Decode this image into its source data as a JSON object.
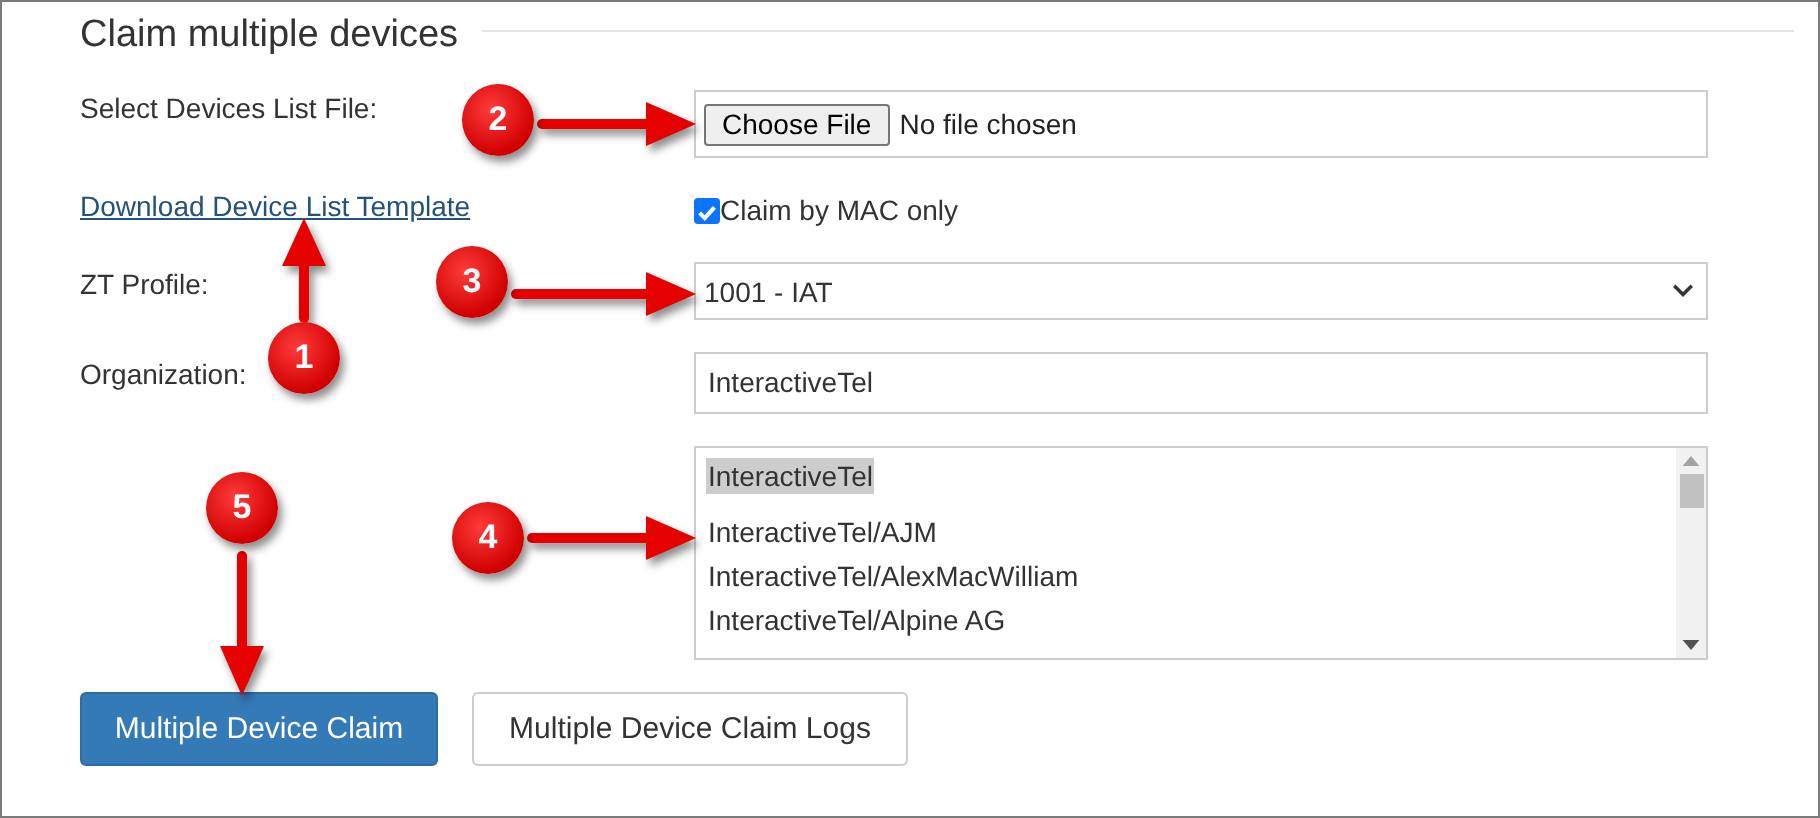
{
  "section": {
    "title": "Claim multiple devices"
  },
  "rows": [
    {
      "left": {
        "kind": "label",
        "text": "Select Devices List File:"
      },
      "right": {
        "kind": "file",
        "button": "Choose File",
        "status": "No file chosen"
      }
    },
    {
      "left": {
        "kind": "link",
        "text": "Download Device List Template"
      },
      "right": {
        "kind": "checkbox",
        "label": "Claim by MAC only",
        "checked": true
      }
    },
    {
      "left": {
        "kind": "label",
        "text": "ZT Profile:"
      },
      "right": {
        "kind": "select",
        "value": "1001 - IAT"
      }
    },
    {
      "left": {
        "kind": "label",
        "text": "Organization:"
      },
      "right": {
        "kind": "input",
        "value": "InteractiveTel"
      }
    },
    {
      "right": {
        "kind": "listbox",
        "items": [
          {
            "text": "InteractiveTel",
            "selected": true
          },
          {
            "text": "InteractiveTel/AJM",
            "selected": false
          },
          {
            "text": "InteractiveTel/AlexMacWilliam",
            "selected": false
          },
          {
            "text": "InteractiveTel/Alpine AG",
            "selected": false
          }
        ]
      }
    }
  ],
  "buttons": [
    {
      "label": "Multiple Device Claim",
      "primary": true
    },
    {
      "label": "Multiple Device Claim Logs",
      "primary": false
    }
  ],
  "annotations": [
    {
      "number": "1",
      "kind": "up"
    },
    {
      "number": "2",
      "kind": "right"
    },
    {
      "number": "3",
      "kind": "right"
    },
    {
      "number": "4",
      "kind": "right"
    },
    {
      "number": "5",
      "kind": "down"
    }
  ]
}
